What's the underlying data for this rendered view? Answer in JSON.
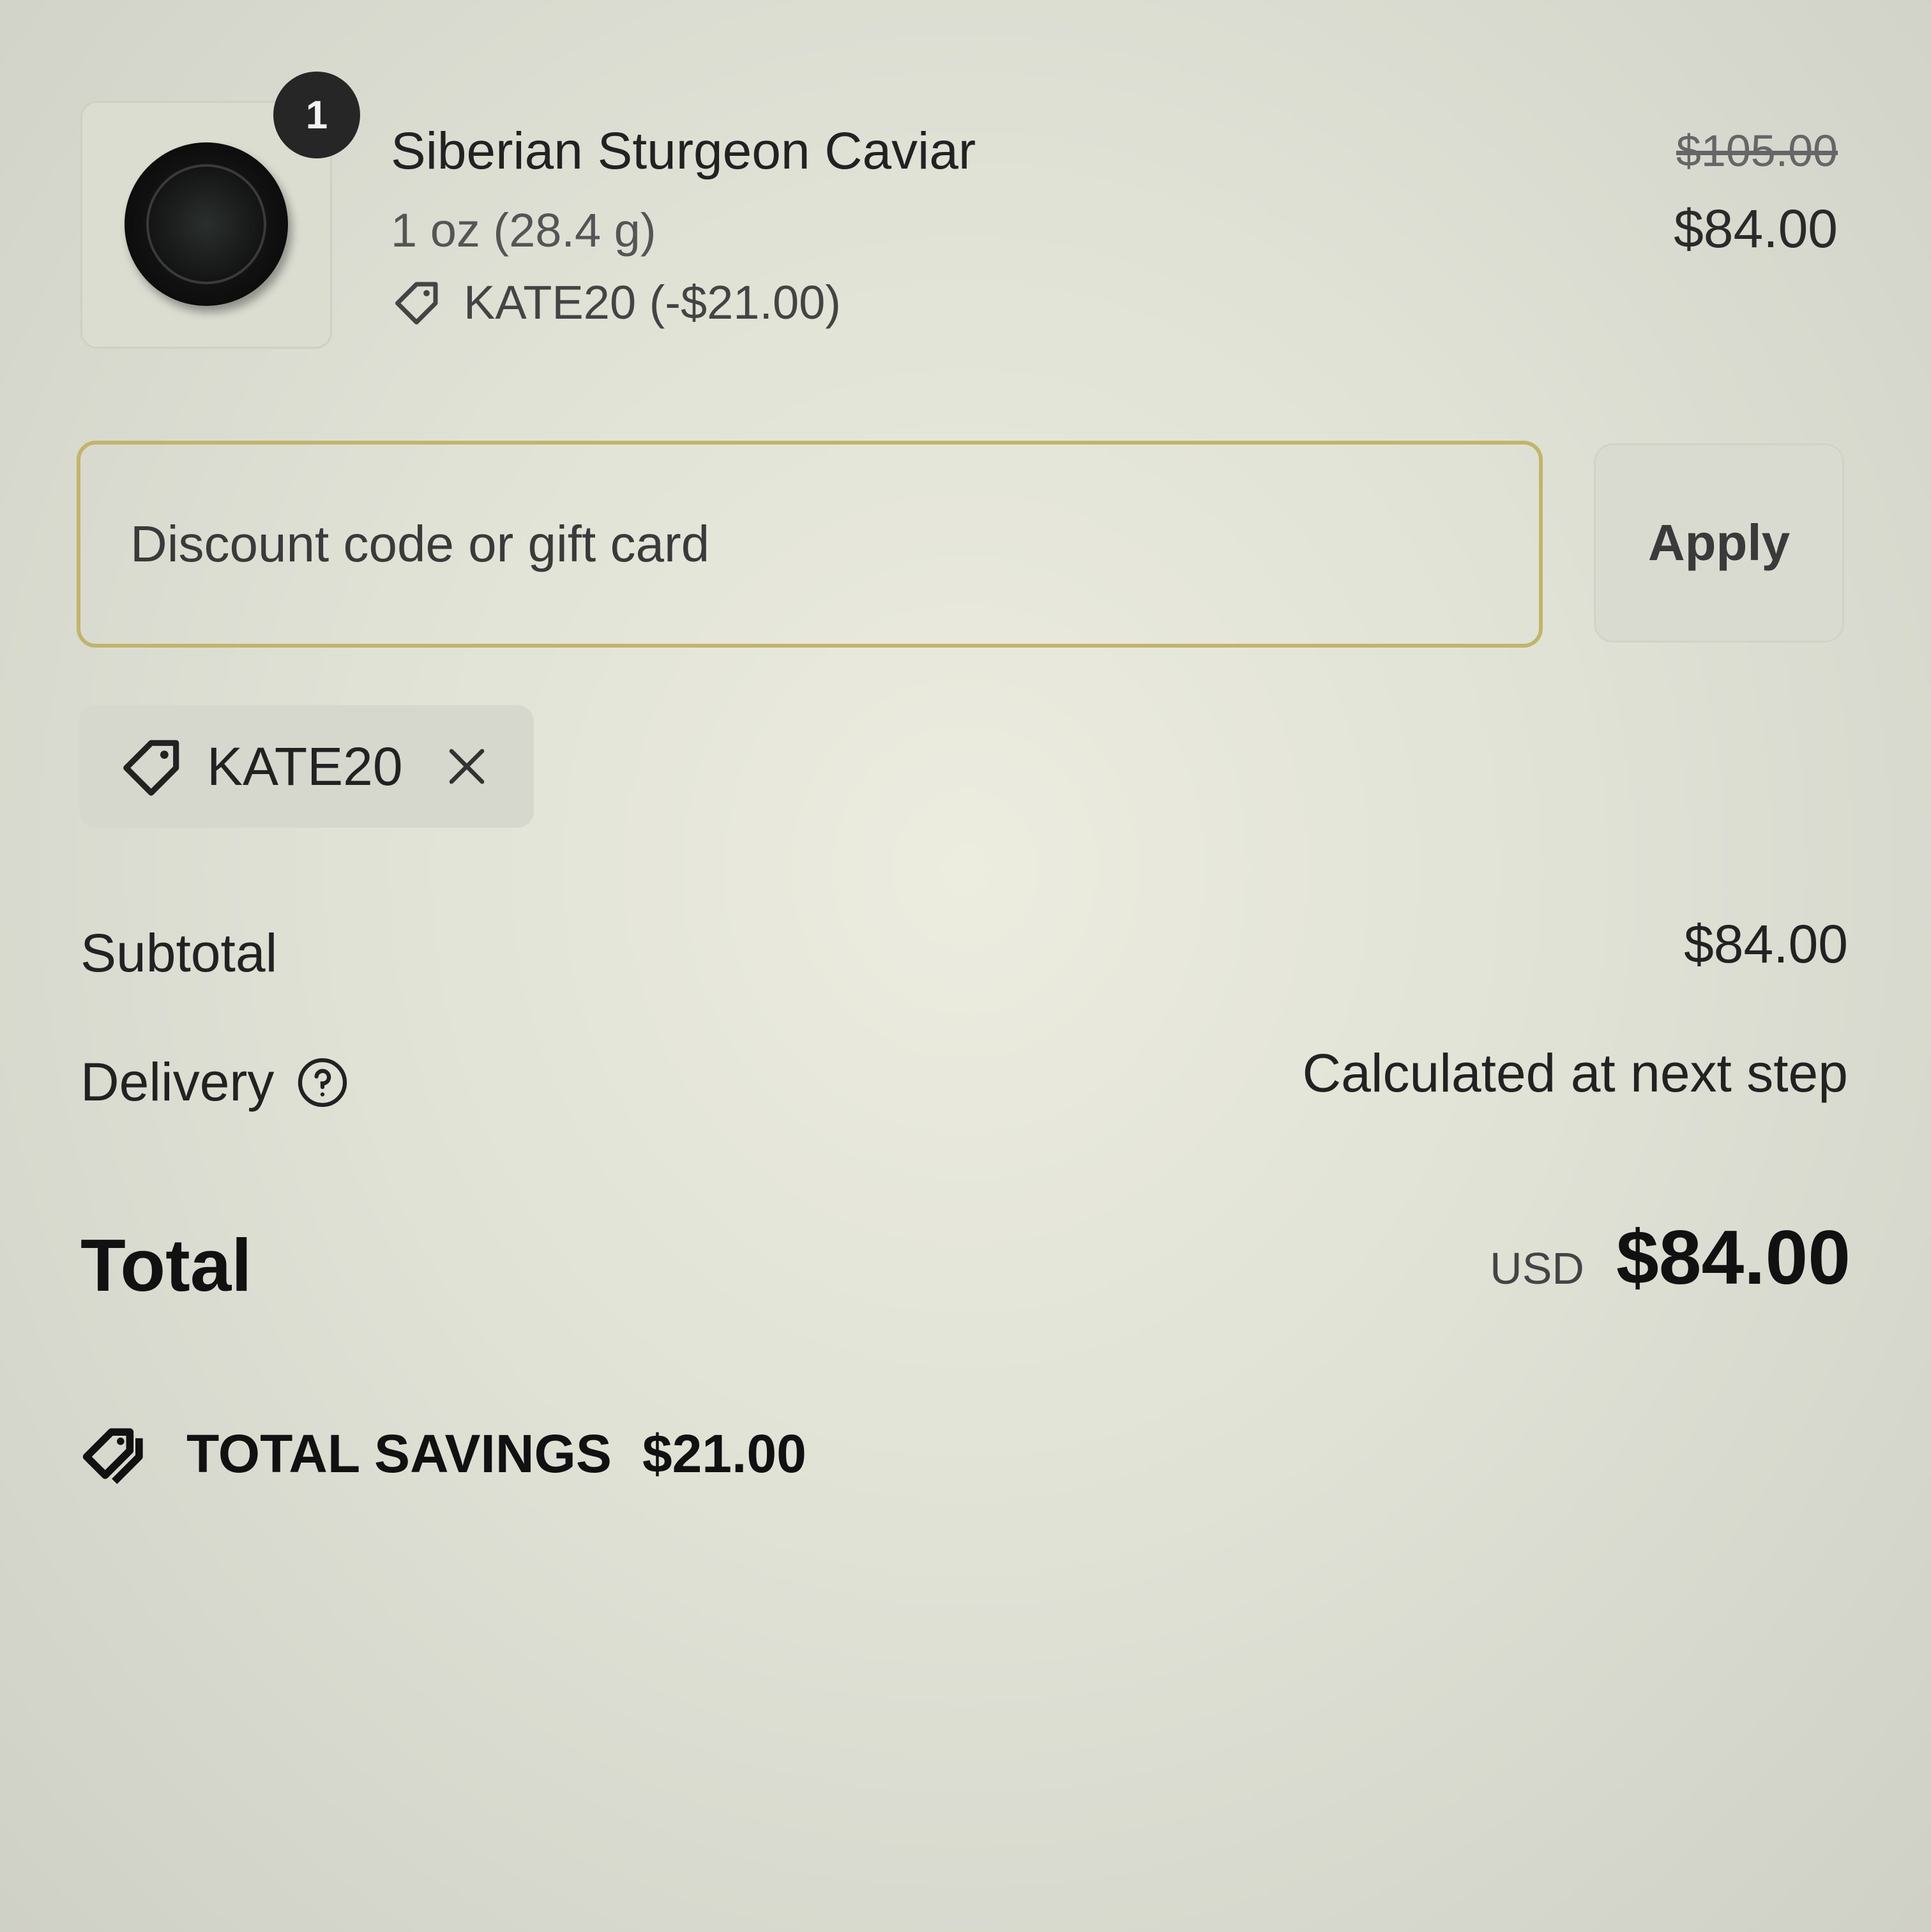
{
  "product": {
    "quantity": "1",
    "name": "Siberian Sturgeon Caviar",
    "variant": "1 oz (28.4 g)",
    "discount_line": "KATE20 (-$21.00)",
    "original_price": "$105.00",
    "price": "$84.00",
    "image_icon": "caviar-tin-icon"
  },
  "discount_form": {
    "placeholder": "Discount code or gift card",
    "apply_label": "Apply",
    "accent_color": "#c2b56a"
  },
  "applied_code": {
    "code": "KATE20"
  },
  "summary": {
    "subtotal_label": "Subtotal",
    "subtotal_value": "$84.00",
    "delivery_label": "Delivery",
    "delivery_value": "Calculated at next step",
    "total_label": "Total",
    "total_currency": "USD",
    "total_value": "$84.00",
    "savings_label": "TOTAL SAVINGS",
    "savings_value": "$21.00"
  }
}
